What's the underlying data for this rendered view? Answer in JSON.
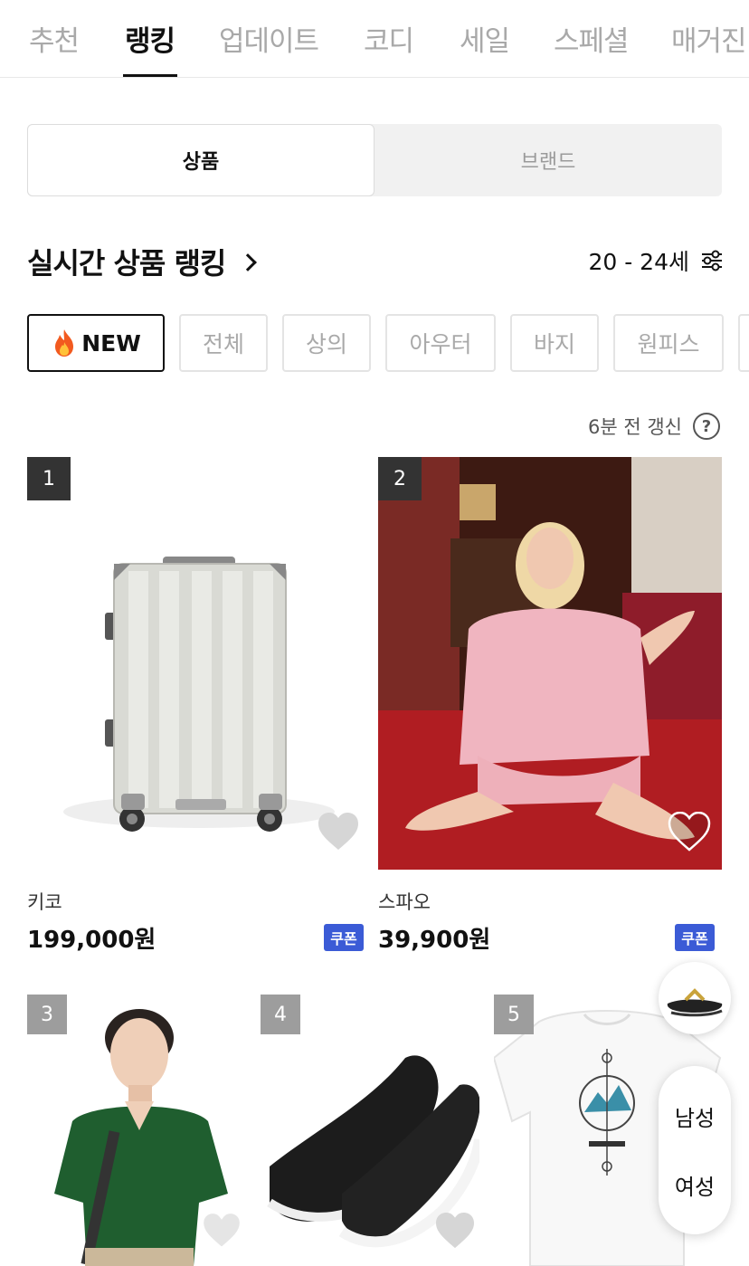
{
  "top_tabs": [
    "추천",
    "랭킹",
    "업데이트",
    "코디",
    "세일",
    "스페셜",
    "매거진"
  ],
  "segment": {
    "active": "상품",
    "inactive": "브랜드"
  },
  "section": {
    "title": "실시간 상품 랭킹",
    "age_range": "20 - 24세"
  },
  "chips": [
    "NEW",
    "전체",
    "상의",
    "아우터",
    "바지",
    "원피스"
  ],
  "updated_text": "6분 전 갱신",
  "help_glyph": "?",
  "products": [
    {
      "rank": "1",
      "brand": "키코",
      "price": "199,000원",
      "coupon": "쿠폰"
    },
    {
      "rank": "2",
      "brand": "스파오",
      "price": "39,900원",
      "coupon": "쿠폰"
    },
    {
      "rank": "3"
    },
    {
      "rank": "4"
    },
    {
      "rank": "5"
    }
  ],
  "gender_toggle": {
    "male": "남성",
    "female": "여성"
  },
  "icons": [
    "filter-icon",
    "help-icon",
    "chevron-right-icon",
    "flame-icon",
    "heart-icon"
  ],
  "colors": {
    "coupon_bg": "#3b5bd6",
    "rank_dark": "#333333",
    "rank_light": "#9d9d9d"
  }
}
